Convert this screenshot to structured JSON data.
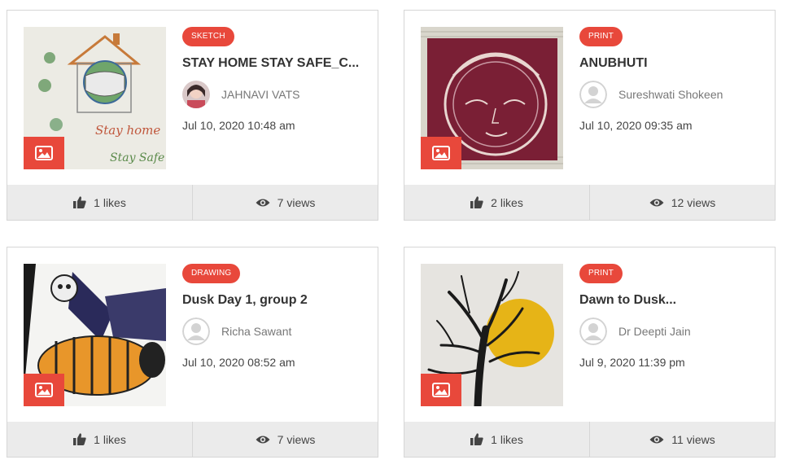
{
  "cards": [
    {
      "category": "SKETCH",
      "title": "STAY HOME STAY SAFE_C...",
      "author": "JAHNAVI VATS",
      "date": "Jul 10, 2020 10:48 am",
      "likes": "1 likes",
      "views": "7 views"
    },
    {
      "category": "PRINT",
      "title": "ANUBHUTI",
      "author": "Sureshwati Shokeen",
      "date": "Jul 10, 2020 09:35 am",
      "likes": "2 likes",
      "views": "12 views"
    },
    {
      "category": "DRAWING",
      "title": "Dusk Day 1, group 2",
      "author": "Richa Sawant",
      "date": "Jul 10, 2020 08:52 am",
      "likes": "1 likes",
      "views": "7 views"
    },
    {
      "category": "PRINT",
      "title": "Dawn to Dusk...",
      "author": "Dr Deepti Jain",
      "date": "Jul 9, 2020 11:39 pm",
      "likes": "1 likes",
      "views": "11 views"
    }
  ],
  "colors": {
    "accent": "#e8483b",
    "stats_bg": "#ebebeb"
  },
  "icons": {
    "image": "image-icon",
    "likes": "thumbs-up-icon",
    "views": "eye-icon",
    "avatar": "user-avatar-icon"
  }
}
